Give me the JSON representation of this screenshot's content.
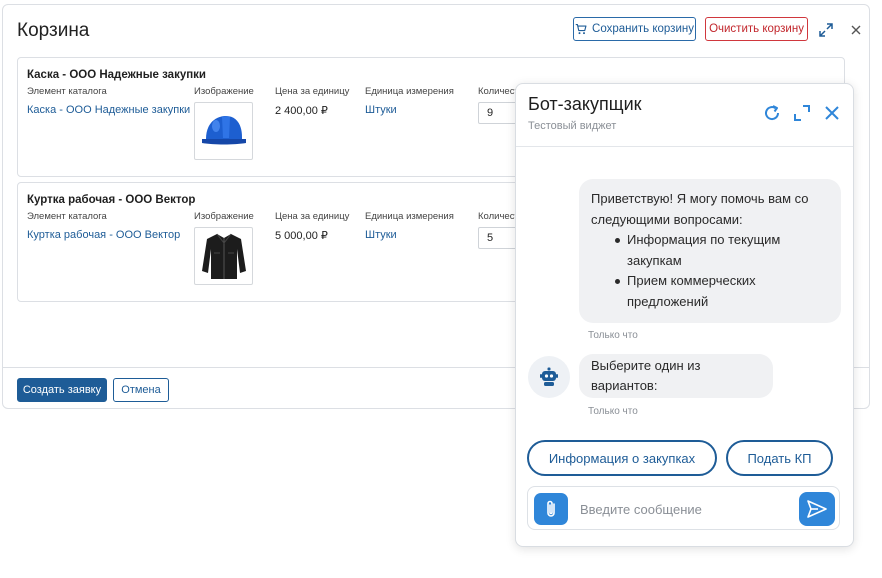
{
  "dialog": {
    "title": "Корзина",
    "save_label": "Сохранить корзину",
    "clear_label": "Очистить корзину",
    "submit_label": "Создать заявку",
    "cancel_label": "Отмена"
  },
  "columns": {
    "catalog": "Элемент каталога",
    "image": "Изображение",
    "price": "Цена за единицу",
    "unit": "Единица измерения",
    "quantity": "Количест"
  },
  "items": [
    {
      "title": "Каска - ООО Надежные закупки",
      "catalog_link": "Каска - ООО Надежные закупки",
      "image_icon": "helmet-icon",
      "price": "2 400,00 ₽",
      "unit": "Штуки",
      "quantity": "9"
    },
    {
      "title": "Куртка рабочая - ООО Вектор",
      "catalog_link": "Куртка рабочая - ООО Вектор",
      "image_icon": "jacket-icon",
      "price": "5 000,00 ₽",
      "unit": "Штуки",
      "quantity": "5"
    }
  ],
  "bot": {
    "title": "Бот-закупщик",
    "subtitle": "Тестовый виджет",
    "greeting_intro": "Приветствую! Я могу помочь вам со следующими вопросами:",
    "greeting_items": [
      "Информация по текущим закупкам",
      "Прием коммерческих предложений"
    ],
    "timestamp": "Только что",
    "prompt": "Выберите один из вариантов:",
    "options": [
      "Информация о закупках",
      "Подать КП"
    ],
    "input_placeholder": "Введите сообщение"
  },
  "colors": {
    "primary": "#1e5c97",
    "danger": "#c2262c",
    "accent": "#2f86d9"
  }
}
